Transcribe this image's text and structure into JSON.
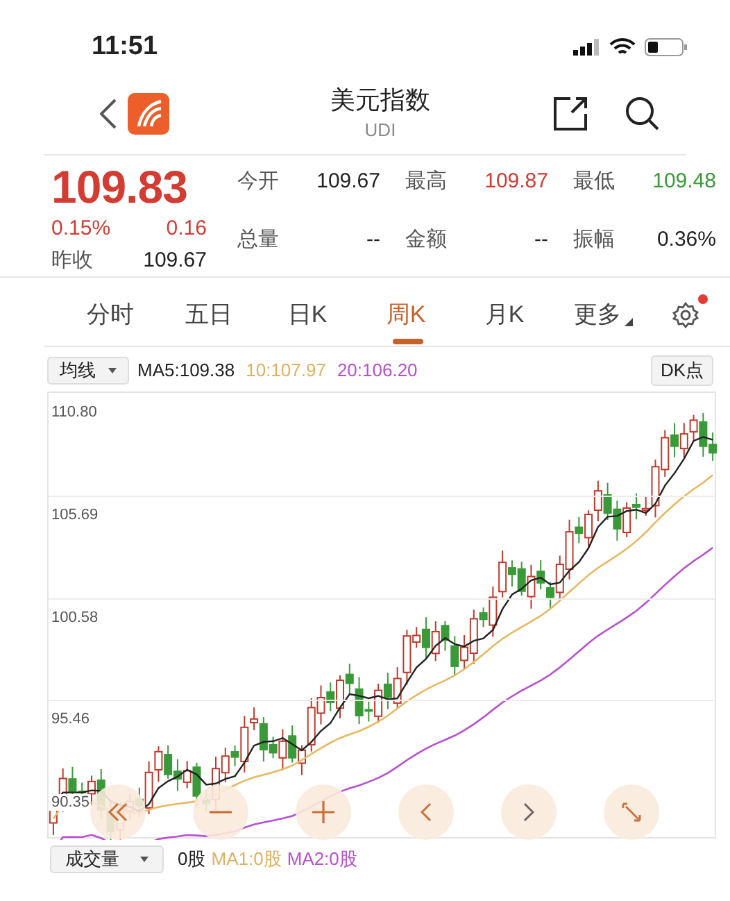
{
  "status_bar": {
    "time": "11:51"
  },
  "header": {
    "title": "美元指数",
    "subtitle": "UDI"
  },
  "quote": {
    "price": "109.83",
    "color": "#d23c32",
    "change_pct": "0.15%",
    "change": "0.16",
    "prev_close_label": "昨收",
    "prev_close": "109.67",
    "stats": [
      {
        "label": "今开",
        "value": "109.67",
        "color": "#222222"
      },
      {
        "label": "最高",
        "value": "109.87",
        "color": "#d23c32"
      },
      {
        "label": "最低",
        "value": "109.48",
        "color": "#3a9a3a"
      },
      {
        "label": "总量",
        "value": "--",
        "color": "#222222"
      },
      {
        "label": "金额",
        "value": "--",
        "color": "#222222"
      },
      {
        "label": "振幅",
        "value": "0.36%",
        "color": "#222222"
      }
    ]
  },
  "tabs": [
    {
      "label": "分时",
      "selected": false,
      "kind": "tab"
    },
    {
      "label": "五日",
      "selected": false,
      "kind": "tab"
    },
    {
      "label": "日K",
      "selected": false,
      "kind": "tab"
    },
    {
      "label": "周K",
      "selected": true,
      "kind": "tab"
    },
    {
      "label": "月K",
      "selected": false,
      "kind": "tab"
    },
    {
      "label": "更多",
      "selected": false,
      "kind": "menu"
    }
  ],
  "settings": {
    "notification": true
  },
  "indicator_bar": {
    "selector": "均线",
    "ma5": "MA5:109.38",
    "ma10": "10:107.97",
    "ma20": "20:106.20",
    "button": "DK点"
  },
  "chart": {
    "price_labels": [
      "110.80",
      "105.69",
      "100.58",
      "95.46",
      "90.35"
    ]
  },
  "chart_controls": [
    {
      "kind": "rewind"
    },
    {
      "kind": "zoom-out"
    },
    {
      "kind": "zoom-in"
    },
    {
      "kind": "back"
    },
    {
      "kind": "forward"
    },
    {
      "kind": "expand"
    }
  ],
  "volume_bar": {
    "selector": "成交量",
    "volume": "0股",
    "ma1": "MA1:0股",
    "ma2": "MA2:0股"
  }
}
